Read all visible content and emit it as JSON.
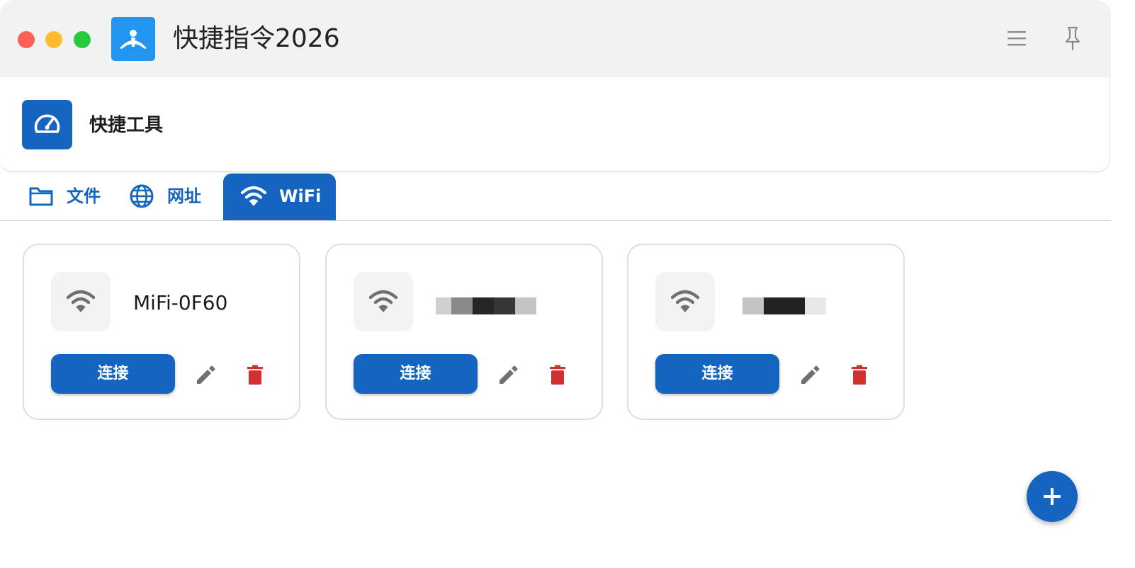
{
  "window": {
    "title": "快捷指令2026",
    "app_icon": "person-arms-icon",
    "controls": [
      "close",
      "minimize",
      "zoom"
    ],
    "toolbar_icons": [
      "hamburger-menu-icon",
      "pin-icon"
    ]
  },
  "header": {
    "icon": "speedometer-icon",
    "title": "快捷工具"
  },
  "tabs": [
    {
      "label": "文件",
      "icon": "folder-icon",
      "active": false
    },
    {
      "label": "网址",
      "icon": "globe-icon",
      "active": false
    },
    {
      "label": "WiFi",
      "icon": "wifi-icon",
      "active": true
    }
  ],
  "wifi_cards": [
    {
      "ssid": "MiFi-0F60",
      "redacted": false,
      "connect_label": "连接",
      "icon": "wifi-icon"
    },
    {
      "ssid": "",
      "redacted": true,
      "connect_label": "连接",
      "icon": "wifi-icon"
    },
    {
      "ssid": "",
      "redacted": true,
      "connect_label": "连接",
      "icon": "wifi-icon"
    }
  ],
  "fab": {
    "icon": "plus-icon"
  },
  "colors": {
    "primary": "#1565c0",
    "app_icon_bg": "#2395f0",
    "delete_red": "#d32f2f",
    "icon_gray": "#707070",
    "titlebar_bg": "#f2f2f2",
    "traffic_red": "#fe5f57",
    "traffic_yellow": "#febc2e",
    "traffic_green": "#28c840"
  }
}
